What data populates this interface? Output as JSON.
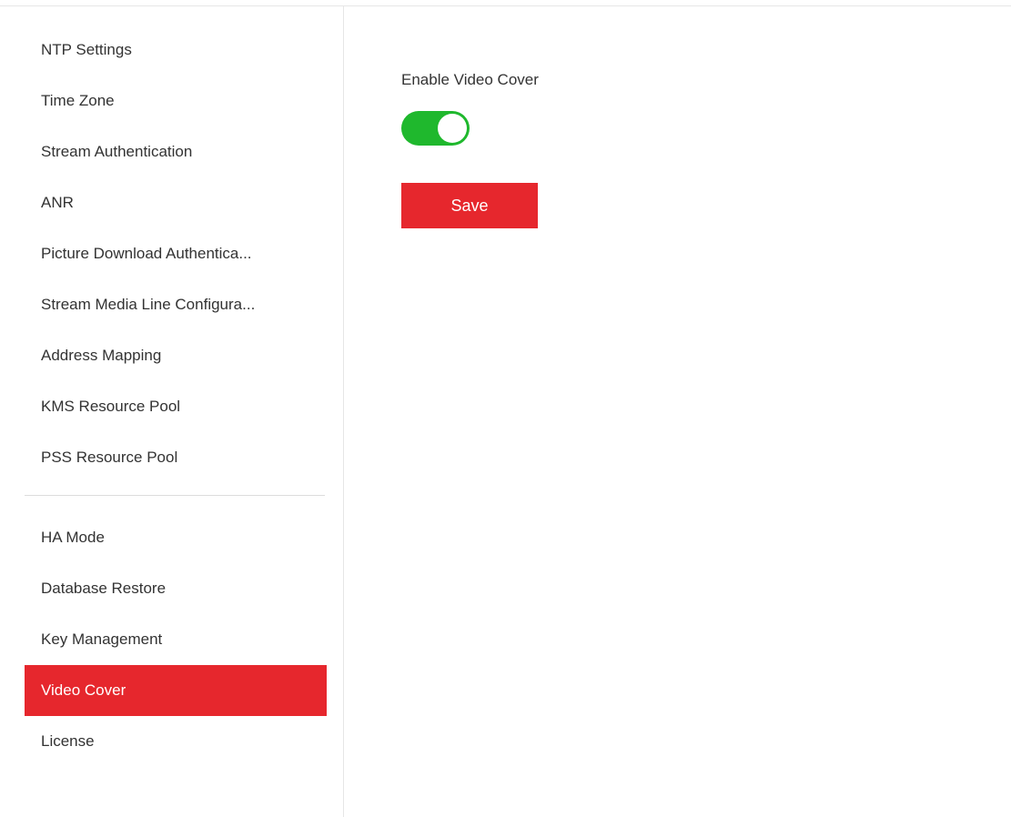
{
  "sidebar": {
    "group1": [
      {
        "label": "NTP Settings"
      },
      {
        "label": "Time Zone"
      },
      {
        "label": "Stream Authentication"
      },
      {
        "label": "ANR"
      },
      {
        "label": "Picture Download Authentica..."
      },
      {
        "label": "Stream Media Line Configura..."
      },
      {
        "label": "Address Mapping"
      },
      {
        "label": "KMS Resource Pool"
      },
      {
        "label": "PSS Resource Pool"
      }
    ],
    "group2": [
      {
        "label": "HA Mode"
      },
      {
        "label": "Database Restore"
      },
      {
        "label": "Key Management"
      },
      {
        "label": "Video Cover",
        "active": true
      },
      {
        "label": "License"
      }
    ]
  },
  "main": {
    "enable_label": "Enable Video Cover",
    "enable_value": true,
    "save_label": "Save"
  },
  "colors": {
    "accent": "#e6272d",
    "toggle_on": "#1fb82d"
  }
}
